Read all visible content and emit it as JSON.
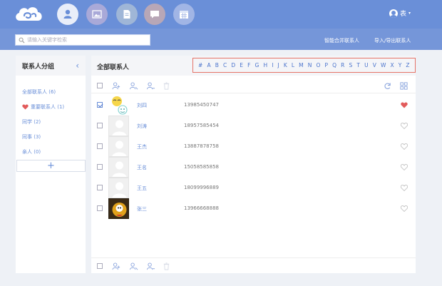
{
  "topbar": {
    "user_name": "表",
    "user_caret": "▾",
    "nav": [
      {
        "icon": "contacts-icon",
        "bg": "#e9eef9",
        "active": true
      },
      {
        "icon": "photo-icon",
        "bg": "#a9a9d8"
      },
      {
        "icon": "document-icon",
        "bg": "#9fb6d7"
      },
      {
        "icon": "message-icon",
        "bg": "#b8a7b7"
      },
      {
        "icon": "calendar-icon",
        "bg": "#a1b5e5"
      }
    ]
  },
  "subbar": {
    "search_placeholder": "请输入关键字检索",
    "link_merge": "智能合并联系人",
    "link_import": "导入/导出联系人"
  },
  "sidebar": {
    "title": "联系人分组",
    "collapse": "‹",
    "groups": [
      {
        "label": "全部联系人 (6)",
        "icon": ""
      },
      {
        "label": "重要联系人 (1)",
        "icon": "heart-icon"
      },
      {
        "label": "同学 (2)",
        "icon": ""
      },
      {
        "label": "同事 (3)",
        "icon": ""
      },
      {
        "label": "亲人 (0)",
        "icon": ""
      }
    ],
    "add_label": "+"
  },
  "main": {
    "title": "全部联系人",
    "alphabet": [
      "#",
      "A",
      "B",
      "C",
      "D",
      "E",
      "F",
      "G",
      "H",
      "I",
      "J",
      "K",
      "L",
      "M",
      "N",
      "O",
      "P",
      "Q",
      "R",
      "S",
      "T",
      "U",
      "V",
      "W",
      "X",
      "Y",
      "Z"
    ],
    "contacts": [
      {
        "name": "刘四",
        "phone": "13985450747",
        "checked": true,
        "favorite": true,
        "avatar": "emoji"
      },
      {
        "name": "刘涛",
        "phone": "18957585454",
        "checked": false,
        "favorite": false,
        "avatar": "default"
      },
      {
        "name": "王杰",
        "phone": "13887878758",
        "checked": false,
        "favorite": false,
        "avatar": "default"
      },
      {
        "name": "王名",
        "phone": "15058585858",
        "checked": false,
        "favorite": false,
        "avatar": "default"
      },
      {
        "name": "王五",
        "phone": "18099996889",
        "checked": false,
        "favorite": false,
        "avatar": "default"
      },
      {
        "name": "张三",
        "phone": "13966668888",
        "checked": false,
        "favorite": false,
        "avatar": "photo"
      }
    ]
  },
  "colors": {
    "brand": "#6a8fd8",
    "highlight_border": "#e57368",
    "favorite": "#e25b5b"
  }
}
